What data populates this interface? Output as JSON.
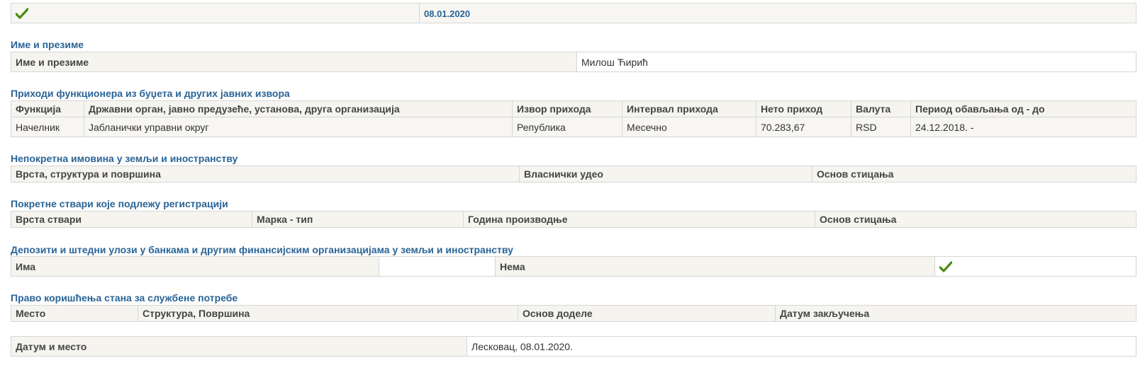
{
  "top_row": {
    "date": "08.01.2020"
  },
  "name_section": {
    "title": "Име и презиме",
    "label": "Име и презиме",
    "value": "Милош Ћирић"
  },
  "income_section": {
    "title": "Приходи функционера из буџета и других јавних извора",
    "columns": [
      "Функција",
      "Државни орган, јавно предузеће, установа, друга организација",
      "Извор прихода",
      "Интервал прихода",
      "Нето приход",
      "Валута",
      "Период обављања од - до"
    ],
    "rows": [
      [
        "Начелник",
        "Јабланички управни округ",
        "Република",
        "Месечно",
        "70.283,67",
        "RSD",
        "24.12.2018. -"
      ]
    ]
  },
  "real_estate_section": {
    "title": "Непокретна имовина у земљи и иностранству",
    "columns": [
      "Врста, структура и површина",
      "Власнички удео",
      "Основ стицања"
    ]
  },
  "movable_section": {
    "title": "Покретне ствари које подлежу регистрацији",
    "columns": [
      "Врста ствари",
      "Марка - тип",
      "Година производње",
      "Основ стицања"
    ]
  },
  "deposits_section": {
    "title": "Депозити и штедни улози у банкама и другим финансијским организацијама у земљи и иностранству",
    "has_label": "Има",
    "none_label": "Нема"
  },
  "apartment_section": {
    "title": "Право коришћења стана за службене потребе",
    "columns": [
      "Место",
      "Структура, Површина",
      "Основ доделе",
      "Датум закључења"
    ]
  },
  "date_place": {
    "label": "Датум и место",
    "value": "Лесковац, 08.01.2020."
  },
  "colors": {
    "accent": "#2a6496",
    "check": "#4a8a12",
    "header_bg": "#f5f4ef",
    "border": "#d6d6d6"
  },
  "icons": {
    "check": "check-icon"
  }
}
